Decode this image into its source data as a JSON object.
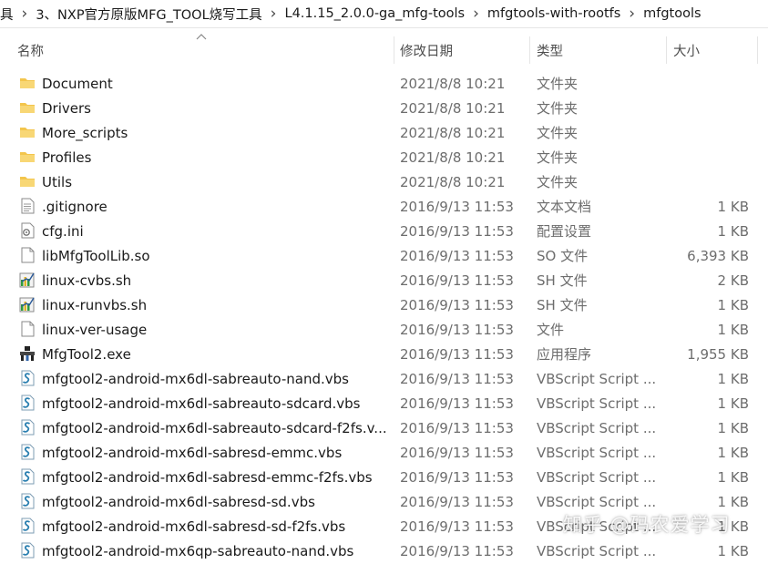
{
  "breadcrumb": [
    "具",
    "3、NXP官方原版MFG_TOOL烧写工具",
    "L4.1.15_2.0.0-ga_mfg-tools",
    "mfgtools-with-rootfs",
    "mfgtools"
  ],
  "columns": {
    "name": "名称",
    "date": "修改日期",
    "type": "类型",
    "size": "大小"
  },
  "files": [
    {
      "icon": "folder-icon",
      "name": "Document",
      "date": "2021/8/8 10:21",
      "type": "文件夹",
      "size": ""
    },
    {
      "icon": "folder-icon",
      "name": "Drivers",
      "date": "2021/8/8 10:21",
      "type": "文件夹",
      "size": ""
    },
    {
      "icon": "folder-icon",
      "name": "More_scripts",
      "date": "2021/8/8 10:21",
      "type": "文件夹",
      "size": ""
    },
    {
      "icon": "folder-icon",
      "name": "Profiles",
      "date": "2021/8/8 10:21",
      "type": "文件夹",
      "size": ""
    },
    {
      "icon": "folder-icon",
      "name": "Utils",
      "date": "2021/8/8 10:21",
      "type": "文件夹",
      "size": ""
    },
    {
      "icon": "text-file-icon",
      "name": ".gitignore",
      "date": "2016/9/13 11:53",
      "type": "文本文档",
      "size": "1 KB"
    },
    {
      "icon": "settings-file-icon",
      "name": "cfg.ini",
      "date": "2016/9/13 11:53",
      "type": "配置设置",
      "size": "1 KB"
    },
    {
      "icon": "file-icon",
      "name": "libMfgToolLib.so",
      "date": "2016/9/13 11:53",
      "type": "SO 文件",
      "size": "6,393 KB"
    },
    {
      "icon": "shell-script-icon",
      "name": "linux-cvbs.sh",
      "date": "2016/9/13 11:53",
      "type": "SH 文件",
      "size": "2 KB"
    },
    {
      "icon": "shell-script-icon",
      "name": "linux-runvbs.sh",
      "date": "2016/9/13 11:53",
      "type": "SH 文件",
      "size": "1 KB"
    },
    {
      "icon": "file-icon",
      "name": "linux-ver-usage",
      "date": "2016/9/13 11:53",
      "type": "文件",
      "size": "1 KB"
    },
    {
      "icon": "application-icon",
      "name": "MfgTool2.exe",
      "date": "2016/9/13 11:53",
      "type": "应用程序",
      "size": "1,955 KB"
    },
    {
      "icon": "vbscript-icon",
      "name": "mfgtool2-android-mx6dl-sabreauto-nand.vbs",
      "date": "2016/9/13 11:53",
      "type": "VBScript Script ...",
      "size": "1 KB"
    },
    {
      "icon": "vbscript-icon",
      "name": "mfgtool2-android-mx6dl-sabreauto-sdcard.vbs",
      "date": "2016/9/13 11:53",
      "type": "VBScript Script ...",
      "size": "1 KB"
    },
    {
      "icon": "vbscript-icon",
      "name": "mfgtool2-android-mx6dl-sabreauto-sdcard-f2fs.v...",
      "date": "2016/9/13 11:53",
      "type": "VBScript Script ...",
      "size": "1 KB"
    },
    {
      "icon": "vbscript-icon",
      "name": "mfgtool2-android-mx6dl-sabresd-emmc.vbs",
      "date": "2016/9/13 11:53",
      "type": "VBScript Script ...",
      "size": "1 KB"
    },
    {
      "icon": "vbscript-icon",
      "name": "mfgtool2-android-mx6dl-sabresd-emmc-f2fs.vbs",
      "date": "2016/9/13 11:53",
      "type": "VBScript Script ...",
      "size": "1 KB"
    },
    {
      "icon": "vbscript-icon",
      "name": "mfgtool2-android-mx6dl-sabresd-sd.vbs",
      "date": "2016/9/13 11:53",
      "type": "VBScript Script ...",
      "size": "1 KB"
    },
    {
      "icon": "vbscript-icon",
      "name": "mfgtool2-android-mx6dl-sabresd-sd-f2fs.vbs",
      "date": "2016/9/13 11:53",
      "type": "VBScript Script ...",
      "size": "1 KB"
    },
    {
      "icon": "vbscript-icon",
      "name": "mfgtool2-android-mx6qp-sabreauto-nand.vbs",
      "date": "2016/9/13 11:53",
      "type": "VBScript Script ...",
      "size": "1 KB"
    }
  ],
  "watermark": "知乎 @码农爱学习",
  "colors": {
    "folder": "#f3c54c",
    "vbscript": "#2a7fb0",
    "shell": "#2f9b3a"
  }
}
